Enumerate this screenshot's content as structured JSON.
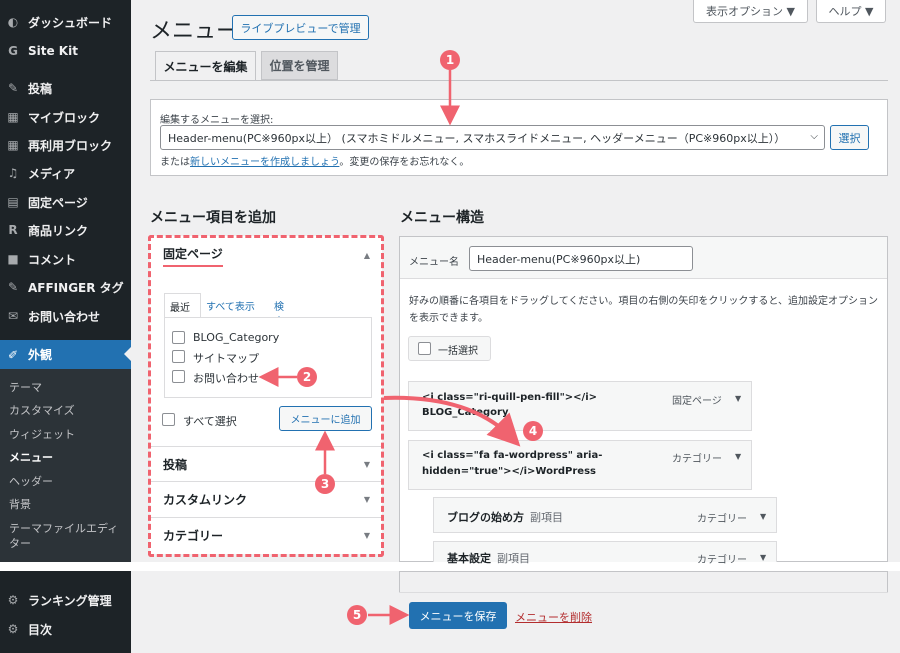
{
  "sidebar": {
    "items": [
      {
        "icon": "dashboard-icon",
        "label": "ダッシュボード"
      },
      {
        "icon": "site-kit-icon",
        "label": "Site Kit"
      },
      {
        "icon": "pin-icon",
        "label": "投稿"
      },
      {
        "icon": "blocks-icon",
        "label": "マイブロック"
      },
      {
        "icon": "blocks-icon",
        "label": "再利用ブロック"
      },
      {
        "icon": "media-icon",
        "label": "メディア"
      },
      {
        "icon": "page-icon",
        "label": "固定ページ"
      },
      {
        "icon": "r-icon",
        "label": "商品リンク"
      },
      {
        "icon": "comment-icon",
        "label": "コメント"
      },
      {
        "icon": "pin-icon",
        "label": "AFFINGER タグ"
      },
      {
        "icon": "mail-icon",
        "label": "お問い合わせ"
      },
      {
        "icon": "brush-icon",
        "label": "外観"
      }
    ],
    "submenu": [
      "テーマ",
      "カスタマイズ",
      "ウィジェット",
      "メニュー",
      "ヘッダー",
      "背景",
      "テーマファイルエディ",
      "ター"
    ],
    "bottom_items": [
      {
        "icon": "gear-icon",
        "label": "ランキング管理"
      },
      {
        "icon": "gear-icon",
        "label": "目次"
      }
    ]
  },
  "header": {
    "screen_options": "表示オプション ▼",
    "help": "ヘルプ ▼",
    "title": "メニュー",
    "live_preview": "ライブプレビューで管理"
  },
  "tabs": [
    "メニューを編集",
    "位置を管理"
  ],
  "select_menu": {
    "label": "編集するメニューを選択:",
    "value": "Header-menu(PC※960px以上） (スマホミドルメニュー, スマホスライドメニュー, ヘッダーメニュー（PC※960px以上））",
    "select_button": "選択",
    "note_prefix": "または",
    "note_link": "新しいメニューを作成しましょう",
    "note_suffix": "。変更の保存をお忘れなく。"
  },
  "add_items": {
    "heading": "メニュー項目を追加",
    "pages_header": "固定ページ",
    "subtabs": [
      "最近",
      "すべて表示",
      "検索"
    ],
    "pages": [
      "BLOG_Category",
      "サイトマップ",
      "お問い合わせ"
    ],
    "select_all": "すべて選択",
    "add_button": "メニューに追加",
    "sections": [
      "投稿",
      "カスタムリンク",
      "カテゴリー"
    ]
  },
  "structure": {
    "heading": "メニュー構造",
    "name_label": "メニュー名",
    "name_value": "Header-menu(PC※960px以上)",
    "instructions": "好みの順番に各項目をドラッグしてください。項目の右側の矢印をクリックすると、追加設定オプションを表示できます。",
    "bulk_select": "一括選択",
    "items": [
      {
        "line1": "<i class=\"ri-quill-pen-fill\"></i>",
        "line2": "BLOG_Category",
        "type": "固定ページ"
      },
      {
        "line1": "<i class=\"fa fa-wordpress\" aria-",
        "line2": "hidden=\"true\"></i>WordPress",
        "type": "カテゴリー"
      },
      {
        "line1": "ブログの始め方",
        "sub": "副項目",
        "type": "カテゴリー"
      },
      {
        "line1": "基本設定",
        "sub": "副項目",
        "type": "カテゴリー"
      }
    ],
    "save_button": "メニューを保存",
    "delete_link": "メニューを削除"
  },
  "annotations": [
    "1",
    "2",
    "3",
    "4",
    "5"
  ],
  "colors": {
    "accent": "#2271b1",
    "sidebar": "#1d2327",
    "annotation": "#f0636f"
  }
}
